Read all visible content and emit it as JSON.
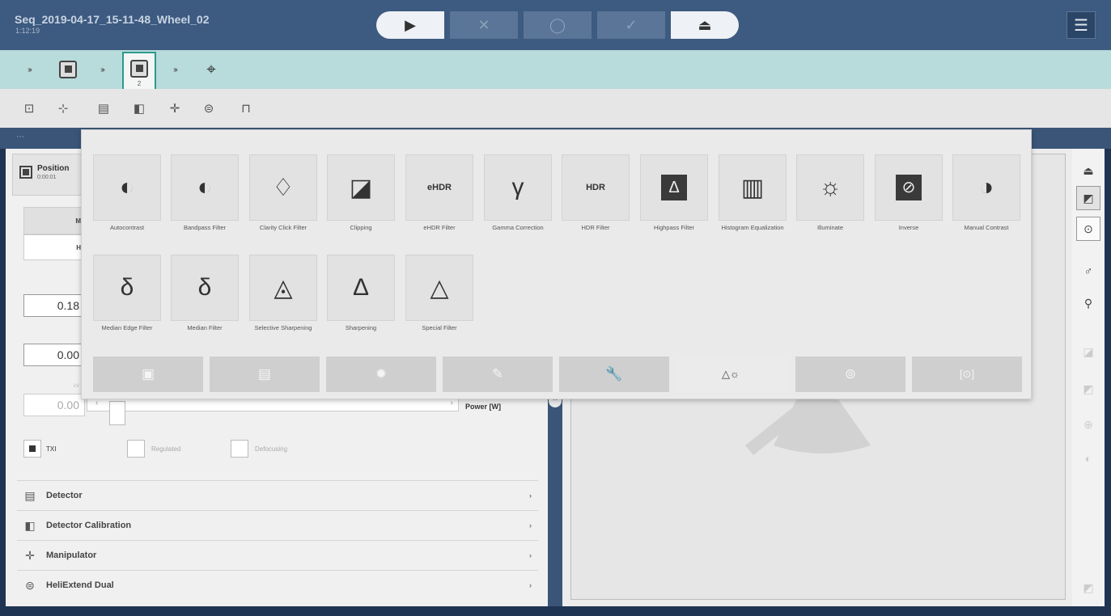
{
  "window": {
    "title": "Seq_2019-04-17_15-11-48_Wheel_02",
    "time": "1:12:19"
  },
  "transport": [
    {
      "name": "play-button",
      "glyph": "▶",
      "state": "on"
    },
    {
      "name": "cancel-button",
      "glyph": "✕",
      "state": "off"
    },
    {
      "name": "record-button",
      "glyph": "◯",
      "state": "off"
    },
    {
      "name": "confirm-button",
      "glyph": "✓",
      "state": "off"
    },
    {
      "name": "eject-button",
      "glyph": "⏏",
      "state": "on"
    }
  ],
  "menu_icon": "☰",
  "chain": {
    "arrow": "›››",
    "active_number": "2",
    "target_icon": "⌖"
  },
  "toolbar_icons": [
    "⊡",
    "⊹",
    "▤",
    "◧",
    "✛",
    "⊜",
    "⊓"
  ],
  "section_strip": "⋯",
  "left_panel": {
    "position_label": "Position",
    "position_time": "0:00:01",
    "seg_a_label": "M",
    "seg_b_label": "H",
    "value1": "0.18",
    "value2": "0.00",
    "value3": "0.00",
    "value3_caption": "kV",
    "slider_left": "‹",
    "slider_right": "›",
    "power_label": "Power [W]",
    "checkbox_txi": "TXI",
    "checkbox_regulated": "Regulated",
    "checkbox_defocusing": "Defocusing",
    "accordion": [
      {
        "icon": "▤",
        "label": "Detector"
      },
      {
        "icon": "◧",
        "label": "Detector Calibration"
      },
      {
        "icon": "✛",
        "label": "Manipulator"
      },
      {
        "icon": "⊜",
        "label": "HeliExtend Dual"
      }
    ],
    "chevron": "›"
  },
  "right_strip_icons": [
    "⏏",
    "◩",
    "⊙",
    "♂",
    "⚲",
    "◪",
    "◩",
    "⊕",
    "◐",
    "◩"
  ],
  "popup": {
    "filters_row1": [
      {
        "label": "Autocontrast",
        "icon": "◐"
      },
      {
        "label": "Bandpass Filter",
        "icon": "◐"
      },
      {
        "label": "Clarity Click Filter",
        "icon": "♢"
      },
      {
        "label": "Clipping",
        "icon": "◪"
      },
      {
        "label": "eHDR Filter",
        "icon": "eHDR"
      },
      {
        "label": "Gamma Correction",
        "icon": "γ"
      },
      {
        "label": "HDR Filter",
        "icon": "HDR"
      },
      {
        "label": "Highpass Filter",
        "icon": "Δ"
      },
      {
        "label": "Histogram Equalization",
        "icon": "▥"
      },
      {
        "label": "Illuminate",
        "icon": "☼"
      },
      {
        "label": "Inverse",
        "icon": "⊘"
      },
      {
        "label": "Manual Contrast",
        "icon": "◑"
      }
    ],
    "filters_row2": [
      {
        "label": "Median Edge Filter",
        "icon": "δ"
      },
      {
        "label": "Median Filter",
        "icon": "δ"
      },
      {
        "label": "Selective Sharpening",
        "icon": "◬"
      },
      {
        "label": "Sharpening",
        "icon": "Δ"
      },
      {
        "label": "Special Filter",
        "icon": "△"
      }
    ],
    "categories": [
      "▣",
      "▤",
      "✹",
      "✎",
      "🔧",
      "△☼",
      "⊚",
      "[⊙]"
    ]
  },
  "collapse_icon": "^"
}
